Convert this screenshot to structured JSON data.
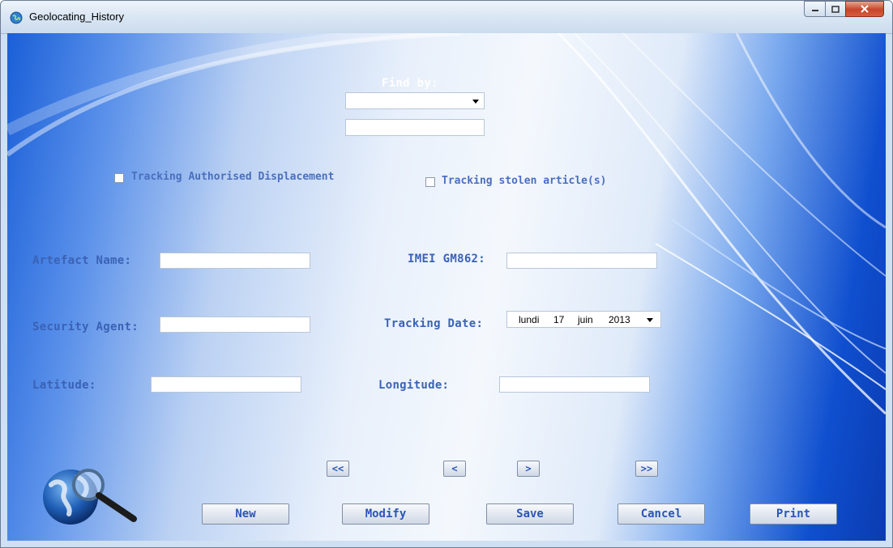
{
  "window": {
    "title": "Geolocating_History"
  },
  "find": {
    "label": "Find by:",
    "selected": "",
    "text_value": ""
  },
  "checkboxes": {
    "authorised": {
      "label": "Tracking Authorised Displacement",
      "checked": false
    },
    "stolen": {
      "label": "Tracking stolen article(s)",
      "checked": false
    }
  },
  "fields": {
    "artefact_name": {
      "label": "Artefact Name:",
      "value": ""
    },
    "imei": {
      "label": "IMEI GM862:",
      "value": ""
    },
    "security_agent": {
      "label": "Security Agent:",
      "value": ""
    },
    "tracking_date": {
      "label": "Tracking Date:",
      "weekday": "lundi",
      "day": "17",
      "month": "juin",
      "year": "2013"
    },
    "latitude": {
      "label": "Latitude:",
      "value": ""
    },
    "longitude": {
      "label": "Longitude:",
      "value": ""
    }
  },
  "navigation": {
    "first": "<<",
    "prev": "<",
    "next": ">",
    "last": ">>"
  },
  "actions": {
    "new": "New",
    "modify": "Modify",
    "save": "Save",
    "cancel": "Cancel",
    "print": "Print"
  },
  "icons": {
    "app": "globe-icon",
    "logo": "globe-magnifier-icon",
    "dropdown": "chevron-down-icon"
  },
  "colors": {
    "label": "#3a62b6",
    "background_accent": "#0f4fcf",
    "close_button": "#c7452c"
  }
}
